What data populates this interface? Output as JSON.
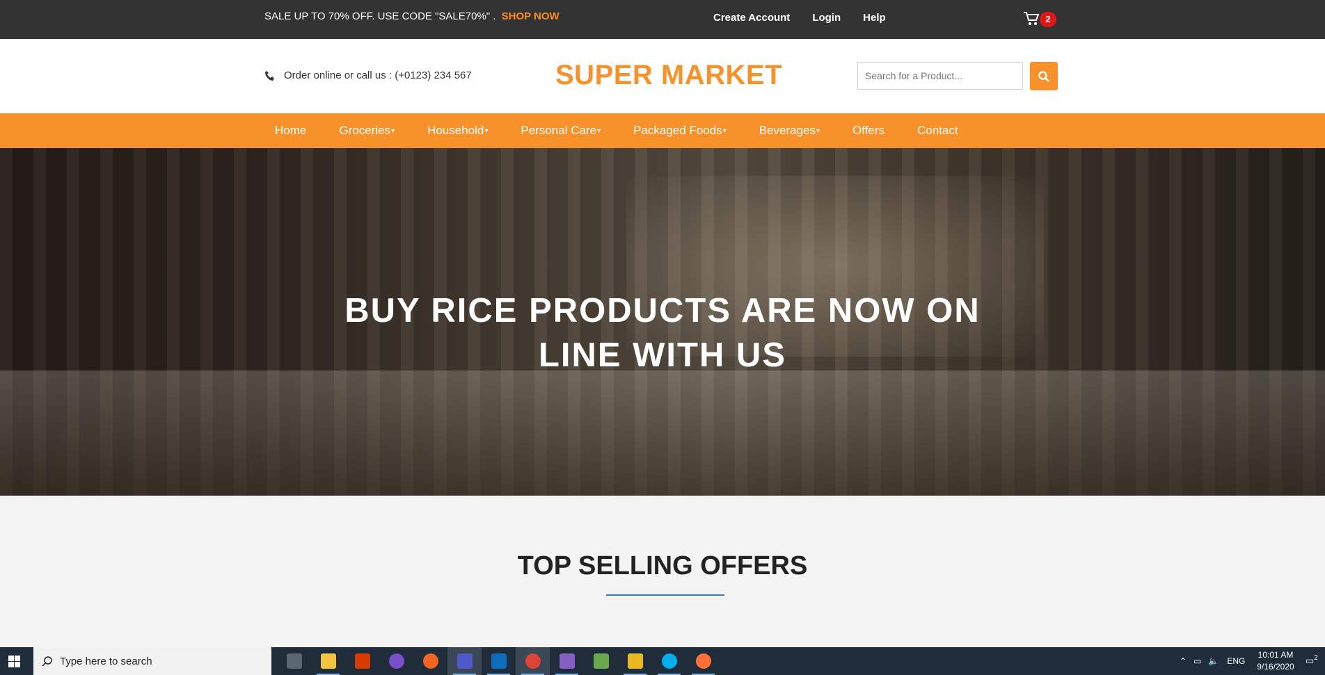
{
  "topbar": {
    "promo_text": "SALE UP TO 70% OFF. USE CODE \"SALE70%\" .",
    "shop_now": "SHOP NOW",
    "links": [
      "Create Account",
      "Login",
      "Help"
    ],
    "cart_count": "2"
  },
  "header": {
    "phone_text": "Order online or call us : (+0123) 234 567",
    "logo": "SUPER MARKET",
    "search_placeholder": "Search for a Product..."
  },
  "nav": {
    "items": [
      {
        "label": "Home",
        "dropdown": false
      },
      {
        "label": "Groceries",
        "dropdown": true
      },
      {
        "label": "Household",
        "dropdown": true
      },
      {
        "label": "Personal Care",
        "dropdown": true
      },
      {
        "label": "Packaged Foods",
        "dropdown": true
      },
      {
        "label": "Beverages",
        "dropdown": true
      },
      {
        "label": "Offers",
        "dropdown": false
      },
      {
        "label": "Contact",
        "dropdown": false
      }
    ]
  },
  "hero": {
    "line1": "BUY RICE PRODUCTS ARE NOW ON",
    "line2": "LINE WITH US"
  },
  "section": {
    "title": "TOP SELLING OFFERS"
  },
  "taskbar": {
    "search_placeholder": "Type here to search",
    "lang": "ENG",
    "time": "10:01 AM",
    "date": "9/16/2020",
    "notif_count": "2"
  },
  "colors": {
    "accent": "#f7922b",
    "topbar": "#333333",
    "badge": "#e0161b"
  }
}
